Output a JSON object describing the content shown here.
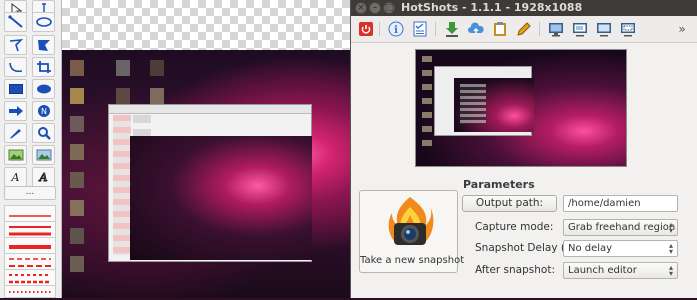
{
  "window": {
    "title": "HotShots - 1.1.1 - 1928x1088",
    "controls": [
      "close-icon",
      "minimize-icon",
      "maximize-icon"
    ]
  },
  "toolbar": {
    "items": [
      {
        "icon": "power-icon",
        "color": "#d9302a"
      },
      {
        "icon": "info-icon",
        "color": "#3b6fc9"
      },
      {
        "icon": "checklist-icon",
        "color": "#3b6fc9"
      },
      {
        "icon": "download-icon",
        "color": "#3a9a3a"
      },
      {
        "icon": "cloud-upload-icon",
        "color": "#4a8fd8"
      },
      {
        "icon": "clipboard-icon",
        "color": "#c98a2a"
      },
      {
        "icon": "pencil-icon",
        "color": "#e0a020"
      },
      {
        "icon": "monitor-icon",
        "color": "#3a5e8a"
      },
      {
        "icon": "window-icon",
        "color": "#3a5e8a"
      },
      {
        "icon": "fullscreen-icon",
        "color": "#3a5e8a"
      },
      {
        "icon": "region-icon",
        "color": "#3a5e8a"
      },
      {
        "icon": "overflow-icon",
        "color": "#555555"
      }
    ]
  },
  "parameters": {
    "title": "Parameters",
    "output_path_button": "Output path:",
    "output_path_value": "/home/damien",
    "capture_mode_label": "Capture mode:",
    "capture_mode_value": "Grab freehand region",
    "snapshot_delay_label": "Snapshot Delay (s):",
    "snapshot_delay_value": "No delay",
    "after_snapshot_label": "After snapshot:",
    "after_snapshot_value": "Launch editor"
  },
  "snapshot_button": {
    "label": "Take a new snapshot",
    "icon": "camera-flame-icon"
  },
  "editor_palette": {
    "tools": [
      "select-icon",
      "text-cursor-icon",
      "line-icon",
      "ellipse-icon",
      "polyline-icon",
      "polygon-icon",
      "curve-icon",
      "crop-icon",
      "rectangle-icon",
      "filled-ellipse-icon",
      "arrow-icon",
      "number-tag-icon",
      "highlighter-icon",
      "zoom-icon",
      "image-icon",
      "image-alt-icon",
      "text-icon",
      "text-outline-icon"
    ],
    "more_button": "...",
    "line_styles": [
      "thin-solid",
      "medium-solid",
      "thick-solid",
      "dashed",
      "dashed-thick",
      "dotted"
    ],
    "accent": "#e8261f"
  }
}
